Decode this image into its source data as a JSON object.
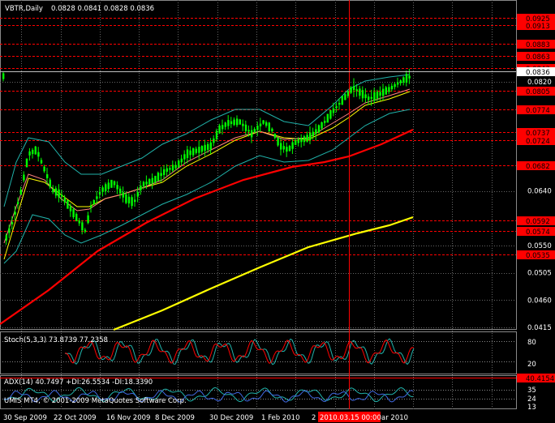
{
  "header": {
    "symbol": "VBTR,Daily",
    "ohlc": "0.0828 0.0841 0.0828 0.0836",
    "copyright": "UMIS MT4, © 2001-2009 MetaQuotes Software Corp."
  },
  "price_axis": {
    "labels": [
      "0.0820",
      "0.0640",
      "0.0550",
      "0.0505",
      "0.0460",
      "0.0415"
    ],
    "current_price": "0.0836"
  },
  "levels": [
    {
      "value": "0.0925"
    },
    {
      "value": "0.0913"
    },
    {
      "value": "0.0883"
    },
    {
      "value": "0.0863"
    },
    {
      "value": "0.0843"
    },
    {
      "value": "0.0805"
    },
    {
      "value": "0.0774"
    },
    {
      "value": "0.0737"
    },
    {
      "value": "0.0724"
    },
    {
      "value": "0.0682"
    },
    {
      "value": "0.0592"
    },
    {
      "value": "0.0574"
    },
    {
      "value": "0.0535"
    }
  ],
  "stoch": {
    "label": "Stoch(5,3,3) 73.8739 77.2358",
    "axis": [
      "80",
      "20"
    ]
  },
  "adx": {
    "label": "ADX(14) 40.7497 +DI:26.5534 -DI:18.3390",
    "axis": [
      "40.4154",
      "35",
      "24",
      "13"
    ]
  },
  "time_axis": {
    "labels": [
      "30 Sep 2009",
      "22 Oct 2009",
      "16 Nov 2009",
      "8 Dec 2009",
      "30 Dec 2009",
      "1 Feb 2010",
      "2",
      "ar 2010"
    ],
    "crosshair_label": "2010.03.15 00:00"
  },
  "colors": {
    "candles": "#00ff00",
    "bollinger": "#20b2aa",
    "ma_fast": "#ff8080",
    "ma_mid": "#ffff00",
    "ma_slow_red": "#ff0000",
    "ma_slow_yellow": "#ffff00",
    "level_line": "#ff0000",
    "stoch_main": "#20b2aa",
    "stoch_signal": "#ff0000"
  }
}
